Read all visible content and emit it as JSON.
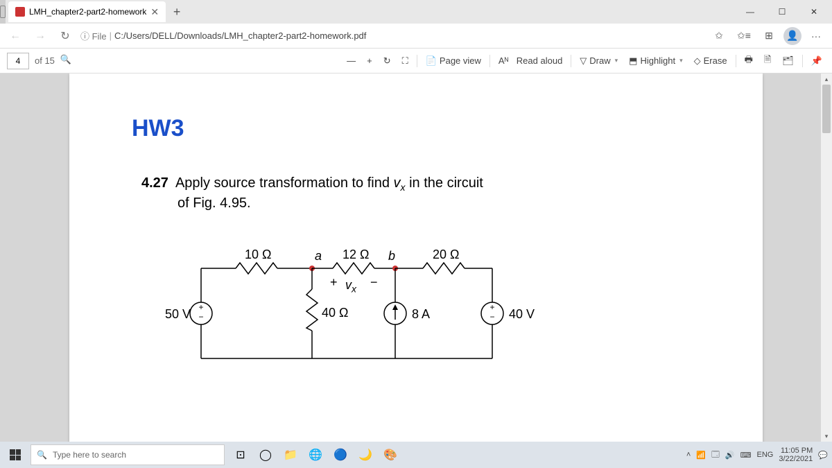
{
  "window": {
    "minimize": "—",
    "maximize": "☐",
    "close": "✕"
  },
  "tab": {
    "title": "LMH_chapter2-part2-homework",
    "close": "✕"
  },
  "nav": {
    "back": "←",
    "forward": "→",
    "refresh": "↻"
  },
  "address": {
    "prefix": "ⓘ File",
    "sep": "|",
    "path": "C:/Users/DELL/Downloads/LMH_chapter2-part2-homework.pdf"
  },
  "addrIcons": {
    "star": "✩",
    "fav": "✩≡",
    "ext": "⊞",
    "more": "···"
  },
  "pdf": {
    "page": "4",
    "of": "of 15",
    "zoomOut": "—",
    "zoomIn": "+",
    "rotate": "↻",
    "fit": "⛶",
    "pageview": "Page view",
    "readaloud": "Read aloud",
    "readpfx": "Aᴺ",
    "draw": "Draw",
    "highlight": "Highlight",
    "erase": "Erase",
    "tool1": "🖶",
    "tool2": "🗎",
    "tool3": "🗂",
    "pin": "📌"
  },
  "doc": {
    "heading": "HW3",
    "problem_num": "4.27",
    "problem_text1": "Apply source transformation to find ",
    "problem_var": "v",
    "problem_sub": "x",
    "problem_text2": " in the circuit",
    "problem_text3": "of Fig. 4.95."
  },
  "circuit": {
    "r10": "10 Ω",
    "r12": "12 Ω",
    "r20": "20 Ω",
    "r40": "40 Ω",
    "a": "a",
    "b": "b",
    "vx": "v",
    "vxsub": "x",
    "plus": "+",
    "minus": "−",
    "v50": "50 V",
    "v40": "40 V",
    "i8": "8 A"
  },
  "taskbar": {
    "search_placeholder": "Type here to search",
    "lang": "ENG",
    "time": "11:05 PM",
    "date": "3/22/2021",
    "trayUp": "˄",
    "wifi": "📶",
    "batt": "🗔",
    "vol": "🔊",
    "kb": "⌨",
    "notif": "💬"
  }
}
